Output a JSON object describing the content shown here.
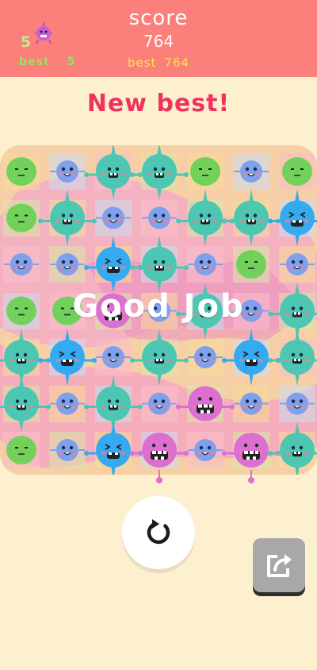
{
  "header": {
    "level": "5",
    "score_label": "score",
    "score_value": "764",
    "best_left_label": "best",
    "best_left_value": "5",
    "best_center_label": "best",
    "best_center_value": "764",
    "avatar_icon": "purple-monster-icon"
  },
  "banner": {
    "new_best": "New best!"
  },
  "board": {
    "overlay_text": "Good Job",
    "rows": [
      [
        "green",
        "blue",
        "teal",
        "teal",
        "green",
        "blue",
        "green"
      ],
      [
        "green",
        "teal",
        "blue",
        "blue",
        "teal",
        "teal",
        "cyan"
      ],
      [
        "blue",
        "blue",
        "cyan",
        "teal",
        "blue",
        "green",
        "blue"
      ],
      [
        "green",
        "green",
        "pink",
        "blue",
        "teal",
        "blue",
        "teal"
      ],
      [
        "teal",
        "cyan",
        "blue",
        "teal",
        "blue",
        "cyan",
        "teal"
      ],
      [
        "teal",
        "blue",
        "teal",
        "blue",
        "pink",
        "blue",
        "blue"
      ],
      [
        "green",
        "blue",
        "cyan",
        "pink",
        "blue",
        "pink",
        "teal"
      ]
    ],
    "colors": {
      "green": "#71d15a",
      "blue": "#7fa0ec",
      "teal": "#4dc6b2",
      "cyan": "#35aaf0",
      "pink": "#dc6fd1"
    }
  },
  "controls": {
    "restart_icon": "restart-icon",
    "share_icon": "share-icon"
  },
  "theme": {
    "header_bg": "#fb7f7a",
    "page_bg": "#fdf0cf",
    "new_best_color": "#f0325e",
    "best_color": "#ffe24a"
  }
}
